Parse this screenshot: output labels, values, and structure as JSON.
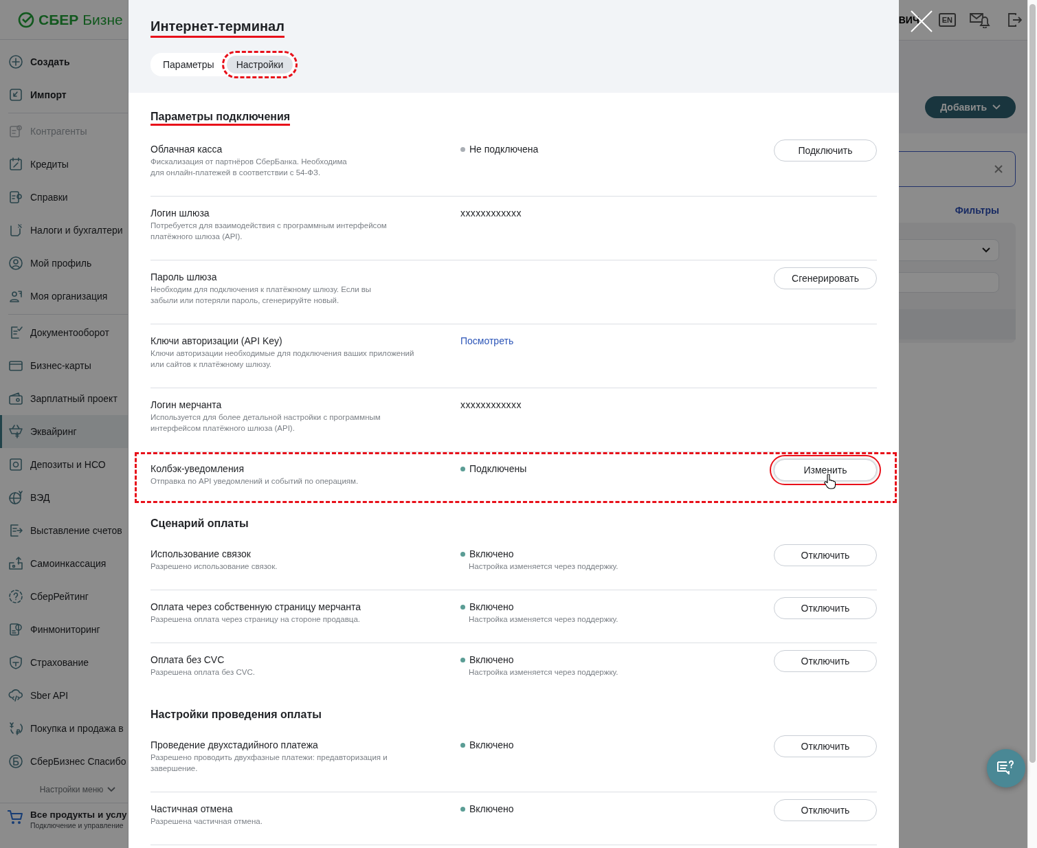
{
  "sidebar": {
    "logo": {
      "brand": "СБЕР",
      "product": "Бизне"
    },
    "groups": [
      [
        {
          "label": "Создать",
          "bold": true,
          "selected": false,
          "disabled": false
        },
        {
          "label": "Импорт",
          "bold": true,
          "selected": false,
          "disabled": false
        }
      ],
      [
        {
          "label": "Контрагенты",
          "bold": false,
          "selected": false,
          "disabled": true
        },
        {
          "label": "Кредиты",
          "bold": false,
          "selected": false,
          "disabled": false
        },
        {
          "label": "Справки",
          "bold": false,
          "selected": false,
          "disabled": false
        },
        {
          "label": "Налоги и бухгалтери",
          "bold": false,
          "selected": false,
          "disabled": false
        },
        {
          "label": "Мой профиль",
          "bold": false,
          "selected": false,
          "disabled": false
        },
        {
          "label": "Моя организация",
          "bold": false,
          "selected": false,
          "disabled": false
        }
      ],
      [
        {
          "label": "Документооборот",
          "bold": false,
          "selected": false,
          "disabled": false
        },
        {
          "label": "Бизнес-карты",
          "bold": false,
          "selected": false,
          "disabled": false
        },
        {
          "label": "Зарплатный проект",
          "bold": false,
          "selected": false,
          "disabled": false
        },
        {
          "label": "Эквайринг",
          "bold": false,
          "selected": true,
          "disabled": false
        },
        {
          "label": "Депозиты и НСО",
          "bold": false,
          "selected": false,
          "disabled": false
        },
        {
          "label": "ВЭД",
          "bold": false,
          "selected": false,
          "disabled": false
        },
        {
          "label": "Выставление счетов",
          "bold": false,
          "selected": false,
          "disabled": false
        },
        {
          "label": "Самоинкассация",
          "bold": false,
          "selected": false,
          "disabled": false
        },
        {
          "label": "СберРейтинг",
          "bold": false,
          "selected": false,
          "disabled": false
        },
        {
          "label": "Финмониторинг",
          "bold": false,
          "selected": false,
          "disabled": false
        },
        {
          "label": "Страхование",
          "bold": false,
          "selected": false,
          "disabled": false
        },
        {
          "label": "Sber API",
          "bold": false,
          "selected": false,
          "disabled": false
        },
        {
          "label": "Покупка и продажа в",
          "bold": false,
          "selected": false,
          "disabled": false
        },
        {
          "label": "СберБизнес Спасибо",
          "bold": false,
          "selected": false,
          "disabled": false
        }
      ]
    ],
    "menu_settings": "Настройки меню",
    "all_products": {
      "title": "Все продукты и услу",
      "subtitle": "Подключение и управление"
    }
  },
  "background": {
    "user_name": "ВИЧ",
    "language": "EN",
    "add_button": "Добавить",
    "filters_link": "Фильтры"
  },
  "modal": {
    "title": "Интернет-терминал",
    "title_marked": true,
    "tabs": [
      {
        "label": "Параметры",
        "selected": false,
        "marked": false
      },
      {
        "label": "Настройки",
        "selected": true,
        "marked": true
      }
    ],
    "sections": [
      {
        "title": "Параметры подключения",
        "marked": true,
        "rows": [
          {
            "kind": "status",
            "title": "Облачная касса",
            "description": "Фискализация от партнёров СберБанка. Необходима\nдля онлайн-платежей в соответствии с 54-ФЗ.",
            "status": "Не подключена",
            "color": "#a9aeb4",
            "button": "Подключить",
            "marked": false,
            "button_marked": false,
            "pointer": false
          },
          {
            "kind": "value",
            "title": "Логин шлюза",
            "description": "Потребуется для взаимодействия с программным интерфейсом\nплатёжного шлюза (API).",
            "value": "xxxxxxxxxxxx",
            "marked": false
          },
          {
            "kind": "plain",
            "title": "Пароль шлюза",
            "description": "Необходим для подключения к платёжному шлюзу. Если вы\nзабыли или потеряли пароль, сгенерируйте новый.",
            "button": "Сгенерировать",
            "marked": false,
            "button_marked": false,
            "pointer": false
          },
          {
            "kind": "link",
            "title": "Ключи авторизации (API Key)",
            "description": "Ключи авторизации необходимые для подключения ваших приложений\nили сайтов к платёжному шлюзу.",
            "link": "Посмотреть",
            "marked": false
          },
          {
            "kind": "value",
            "title": "Логин мерчанта",
            "description": "Используется для более детальной настройки с программным\nинтерфейсом платёжного шлюза (API).",
            "value": "xxxxxxxxxxxx",
            "marked": false
          },
          {
            "kind": "status",
            "title": "Колбэк-уведомления",
            "description": "Отправка по API уведомлений и событий по операциям.",
            "status": "Подключены",
            "color": "#5b9d95",
            "button": "Изменить",
            "marked": true,
            "button_marked": true,
            "pointer": true
          }
        ]
      },
      {
        "title": "Сценарий оплаты",
        "marked": false,
        "rows": [
          {
            "kind": "status",
            "title": "Использование связок",
            "description": "Разрешено использование связок.",
            "status": "Включено",
            "note": "Настройка изменяется через поддержку.",
            "color": "#5b9d95",
            "button": "Отключить",
            "marked": false,
            "button_marked": false,
            "pointer": false
          },
          {
            "kind": "status",
            "title": "Оплата через собственную страницу мерчанта",
            "description": "Разрешена оплата через страницу на стороне продавца.",
            "status": "Включено",
            "note": "Настройка изменяется через поддержку.",
            "color": "#5b9d95",
            "button": "Отключить",
            "marked": false,
            "button_marked": false,
            "pointer": false
          },
          {
            "kind": "status",
            "title": "Оплата без CVC",
            "description": "Разрешена оплата без CVC.",
            "status": "Включено",
            "note": "Настройка изменяется через поддержку.",
            "color": "#5b9d95",
            "button": "Отключить",
            "marked": false,
            "button_marked": false,
            "pointer": false
          }
        ]
      },
      {
        "title": "Настройки проведения оплаты",
        "marked": false,
        "rows": [
          {
            "kind": "status",
            "title": "Проведение двухстадийного платежа",
            "description": "Разрешено проводить двухфазные платежи: предавторизация и\nзавершение.",
            "status": "Включено",
            "color": "#5b9d95",
            "button": "Отключить",
            "marked": false,
            "button_marked": false,
            "pointer": false
          },
          {
            "kind": "status",
            "title": "Частичная отмена",
            "description": "Разрешена частичная отмена.",
            "status": "Включено",
            "color": "#5b9d95",
            "button": "Отключить",
            "marked": false,
            "button_marked": false,
            "pointer": false
          }
        ]
      }
    ]
  }
}
